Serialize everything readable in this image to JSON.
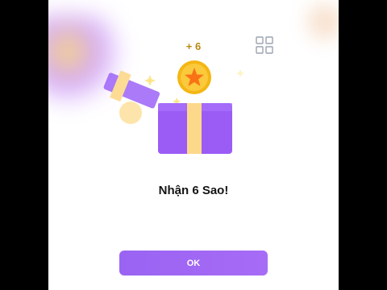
{
  "reward": {
    "amount_label": "+ 6",
    "message": "Nhận 6 Sao!"
  },
  "actions": {
    "ok_label": "OK"
  },
  "icons": {
    "coin": "star-coin-icon",
    "gift": "gift-box-icon",
    "grid": "grid-menu-icon"
  },
  "colors": {
    "accent": "#9b63f3",
    "coin": "#fbbf24",
    "box": "#9b5cf6",
    "ribbon": "#fcd98a"
  }
}
